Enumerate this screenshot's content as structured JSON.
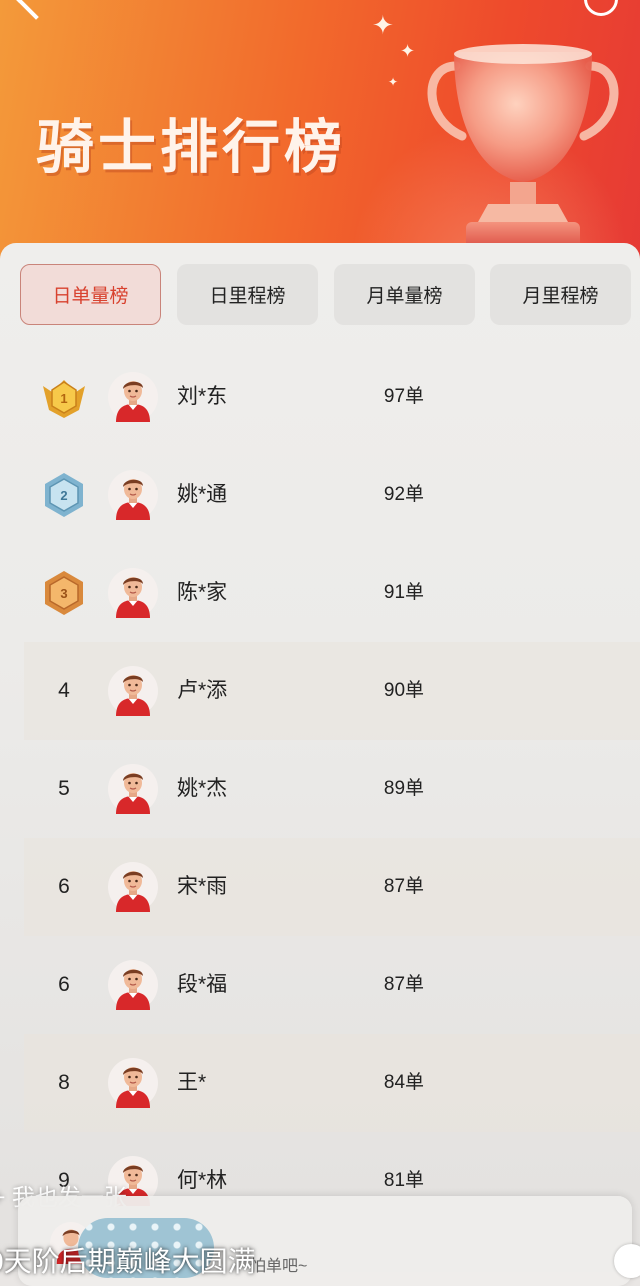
{
  "header": {
    "title": "骑士排行榜"
  },
  "tabs": [
    {
      "label": "日单量榜",
      "active": true
    },
    {
      "label": "日里程榜",
      "active": false
    },
    {
      "label": "月单量榜",
      "active": false
    },
    {
      "label": "月里程榜",
      "active": false
    }
  ],
  "rows": [
    {
      "rank": "1",
      "medal": "gold",
      "name": "刘*东",
      "count": "97单"
    },
    {
      "rank": "2",
      "medal": "silver",
      "name": "姚*通",
      "count": "92单"
    },
    {
      "rank": "3",
      "medal": "bronze",
      "name": "陈*家",
      "count": "91单"
    },
    {
      "rank": "4",
      "name": "卢*添",
      "count": "90单"
    },
    {
      "rank": "5",
      "name": "姚*杰",
      "count": "89单"
    },
    {
      "rank": "6",
      "name": "宋*雨",
      "count": "87单"
    },
    {
      "rank": "6",
      "name": "段*福",
      "count": "87单"
    },
    {
      "rank": "8",
      "name": "王*",
      "count": "84单"
    },
    {
      "rank": "9",
      "name": "何*林",
      "count": "81单"
    }
  ],
  "overlay": {
    "post_label": "+ 我也发一张",
    "card_hint": "怕单吧~",
    "caption": "0天阶后期巅峰大圆满"
  },
  "colors": {
    "accent": "#d8422f",
    "header_start": "#f39a3a",
    "header_end": "#e63a35"
  }
}
